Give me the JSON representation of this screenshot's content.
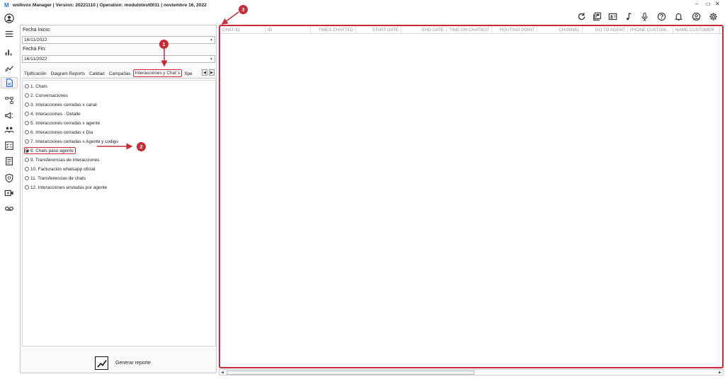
{
  "window": {
    "title": "wolkvox Manager  | Version: 20221110 |  Operation: modulotest0011 | noviembre 16, 2022",
    "logo_letter": "M"
  },
  "filters": {
    "start_label": "Fecha Inicio:",
    "start_value": "16/11/2022",
    "end_label": "Fecha Fin:",
    "end_value": "16/11/2022"
  },
  "tabs": [
    "Tipificación",
    "Diagram Reports",
    "Calidad",
    "Campañas",
    "Interacciones y Chat´s",
    "Spe"
  ],
  "reports": [
    "1. Chats",
    "2. Conversaciones",
    "3. Interacciones cerradas x canal",
    "4. Interacciones - Detalle",
    "5. Interacciones cerradas x agente",
    "6. Interacciones cerradas x Dia",
    "7. Interacciones cerradas x Agente y codigo",
    "8. Chats paso agente",
    "9. Transferencias de interacciones",
    "10. Facturación whatsapp oficial",
    "11. Transferencias de chats",
    "12. Interacciones enviadas por agente"
  ],
  "selected_report": "8. Chats paso agente",
  "generate_label": "Generar reporte",
  "grid_columns": [
    "CHAT-ID",
    "ID",
    "TIMES CHATTED",
    "START DATE",
    "END DATE",
    "TIME ON CHATBOT",
    "ROUTING POINT",
    "CHANNEL",
    "GO TO AGENT",
    "PHONE CUSTOM...",
    "NAME CUSTOMER"
  ],
  "callouts": [
    "1",
    "2",
    "3"
  ],
  "colors": {
    "accent": "#c62b38",
    "logo": "#2a6fd6"
  },
  "icons": {
    "sidebar": [
      "user-icon",
      "menu-icon",
      "bar-chart-icon",
      "line-chart-icon",
      "report-icon",
      "hierarchy-icon",
      "megaphone-icon",
      "team-icon",
      "checklist-icon",
      "document-icon",
      "shield-icon",
      "video-add-icon",
      "voicemail-icon"
    ],
    "toolbar": [
      "refresh-icon",
      "library-icon",
      "contact-card-icon",
      "music-icon",
      "microphone-icon",
      "help-icon",
      "bell-icon",
      "account-icon",
      "settings-icon"
    ]
  }
}
